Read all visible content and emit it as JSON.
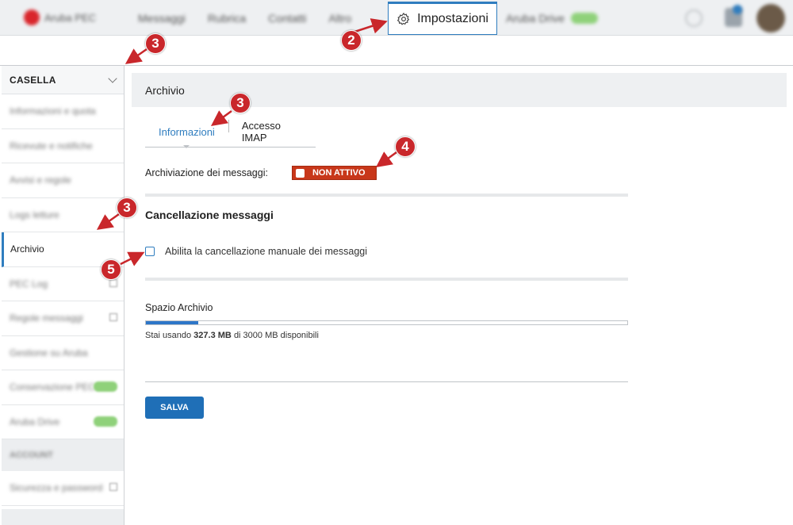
{
  "topbar": {
    "brand": "Aruba PEC",
    "nav": [
      "Messaggi",
      "Rubrica",
      "Contatti",
      "Altro"
    ],
    "active_tab": "Impostazioni",
    "extra_item": "Aruba Drive"
  },
  "sidebar": {
    "header": "CASELLA",
    "items": [
      {
        "label": "Informazioni e quota",
        "badge": false,
        "ext": false
      },
      {
        "label": "Ricevute e notifiche",
        "badge": false,
        "ext": false
      },
      {
        "label": "Avvisi e regole",
        "badge": false,
        "ext": false
      },
      {
        "label": "Logs letture",
        "badge": false,
        "ext": false
      },
      {
        "label": "Archivio",
        "badge": false,
        "ext": false,
        "active": true
      },
      {
        "label": "PEC Log",
        "badge": false,
        "ext": true
      },
      {
        "label": "Regole messaggi",
        "badge": false,
        "ext": true
      },
      {
        "label": "Gestione su Aruba",
        "badge": false,
        "ext": false
      },
      {
        "label": "Conservazione PEC",
        "badge": true,
        "ext": false
      },
      {
        "label": "Aruba Drive",
        "badge": true,
        "ext": false
      }
    ],
    "section": "ACCOUNT",
    "after_section": [
      {
        "label": "Sicurezza e password",
        "ext": true
      }
    ]
  },
  "main": {
    "title": "Archivio",
    "tabs": [
      {
        "label": "Informazioni",
        "active": true
      },
      {
        "label": "Accesso IMAP",
        "active": false
      }
    ],
    "archiving_label": "Archiviazione dei messaggi:",
    "toggle_text": "NON ATTIVO",
    "delete_section_title": "Cancellazione messaggi",
    "delete_checkbox_label": "Abilita la cancellazione manuale dei messaggi",
    "space_title": "Spazio Archivio",
    "usage": {
      "prefix": "Stai usando",
      "used": "327.3 MB",
      "suffix": "di 3000 MB disponibili",
      "used_mb": 327.3,
      "total_mb": 3000
    },
    "save_label": "SALVA"
  },
  "callouts": [
    "2",
    "3",
    "3",
    "3",
    "4",
    "5"
  ],
  "colors": {
    "accent": "#2f7dbf",
    "toggle_off": "#c8371a",
    "callout": "#c9272b",
    "button": "#1f6fb7"
  }
}
